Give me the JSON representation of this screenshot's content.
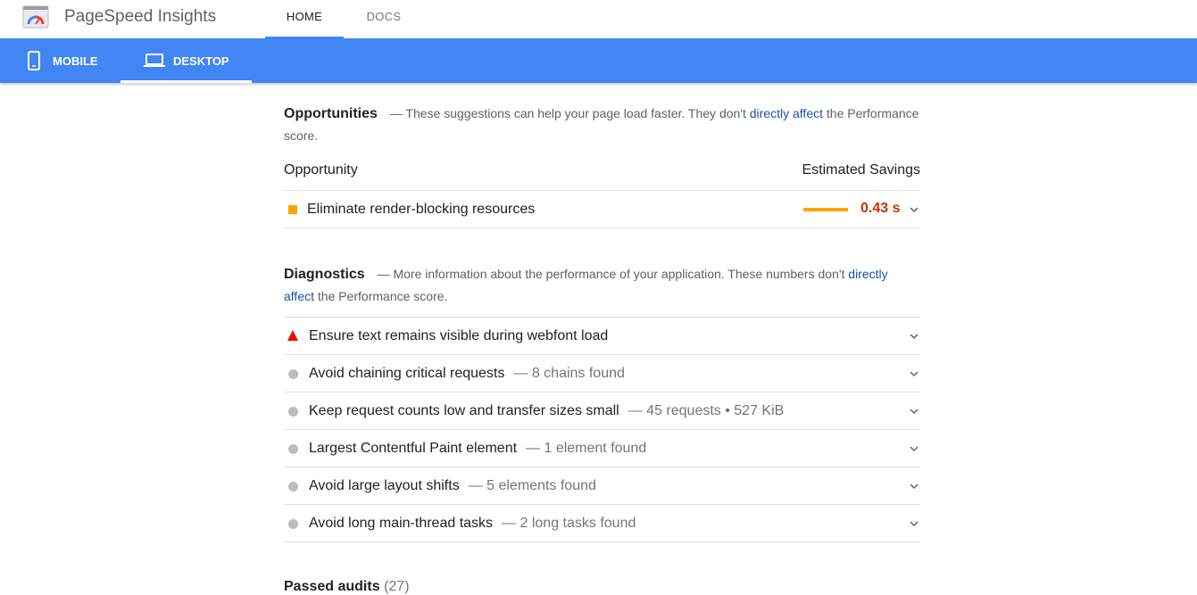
{
  "header": {
    "brand": "PageSpeed Insights",
    "nav": [
      {
        "label": "HOME"
      },
      {
        "label": "DOCS"
      }
    ],
    "devices": [
      {
        "label": "MOBILE",
        "icon": "phone-icon"
      },
      {
        "label": "DESKTOP",
        "icon": "laptop-icon"
      }
    ]
  },
  "opportunities": {
    "title": "Opportunities",
    "desc_prefix": "— These suggestions can help your page load faster. They don't",
    "link": "directly affect",
    "desc_suffix": "the Performance score.",
    "col_left": "Opportunity",
    "col_right": "Estimated Savings",
    "items": [
      {
        "label": "Eliminate render-blocking resources",
        "savings": "0.43 s"
      }
    ]
  },
  "diagnostics": {
    "title": "Diagnostics",
    "desc_prefix": "— More information about the performance of your application. These numbers don't",
    "link": "directly affect",
    "desc_suffix": "the Performance score.",
    "items": [
      {
        "label": "Ensure text remains visible during webfont load",
        "detail": "",
        "status": "fail"
      },
      {
        "label": "Avoid chaining critical requests",
        "detail": "— 8 chains found",
        "status": "info"
      },
      {
        "label": "Keep request counts low and transfer sizes small",
        "detail": "— 45 requests • 527 KiB",
        "status": "info"
      },
      {
        "label": "Largest Contentful Paint element",
        "detail": "— 1 element found",
        "status": "info"
      },
      {
        "label": "Avoid large layout shifts",
        "detail": "— 5 elements found",
        "status": "info"
      },
      {
        "label": "Avoid long main-thread tasks",
        "detail": "— 2 long tasks found",
        "status": "info"
      }
    ]
  },
  "passed": {
    "title": "Passed audits",
    "count": "(27)"
  },
  "colors": {
    "accent": "#4285f4",
    "warn": "#ffa400",
    "fail": "#eb0f00",
    "savings": "#c33300",
    "link": "#1a52a5"
  }
}
